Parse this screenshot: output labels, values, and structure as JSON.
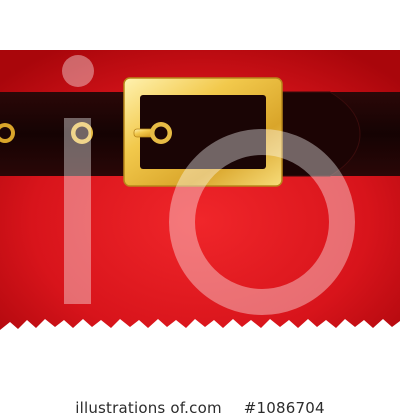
{
  "scene": {
    "subject": "santa-suit-belt",
    "colors": {
      "suit_red": "#e31a21",
      "suit_red_dark": "#b5070c",
      "belt_black": "#1a0505",
      "buckle_gold": "#f2c94c",
      "buckle_gold_dark": "#c9961c",
      "fur_white": "#ffffff"
    },
    "belt_holes_visible": 3
  },
  "watermark": {
    "logo_text": "iO"
  },
  "caption": {
    "site": "illustrations of.com",
    "image_number": "#1086704"
  }
}
